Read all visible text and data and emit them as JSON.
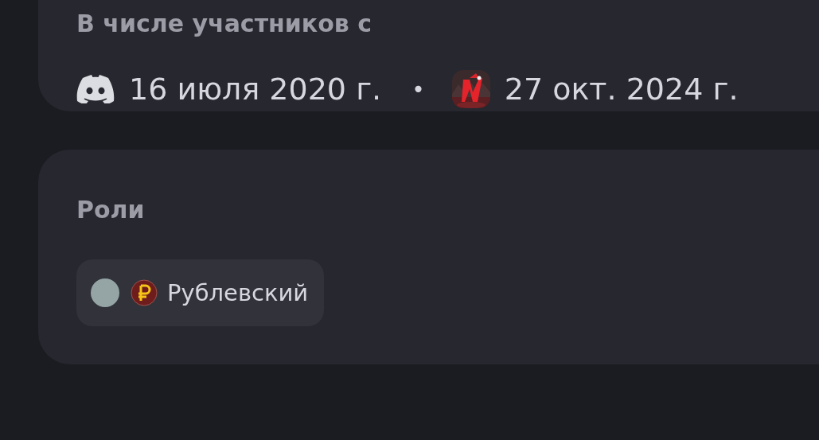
{
  "member_since": {
    "heading": "В числе участников с",
    "entries": [
      {
        "kind": "discord",
        "date": "16 июля 2020 г."
      },
      {
        "kind": "server",
        "date": "27 окт. 2024 г."
      }
    ],
    "separator": "•"
  },
  "roles": {
    "heading": "Роли",
    "items": [
      {
        "name": "Рублевский",
        "color": "#95a5a6"
      }
    ]
  }
}
